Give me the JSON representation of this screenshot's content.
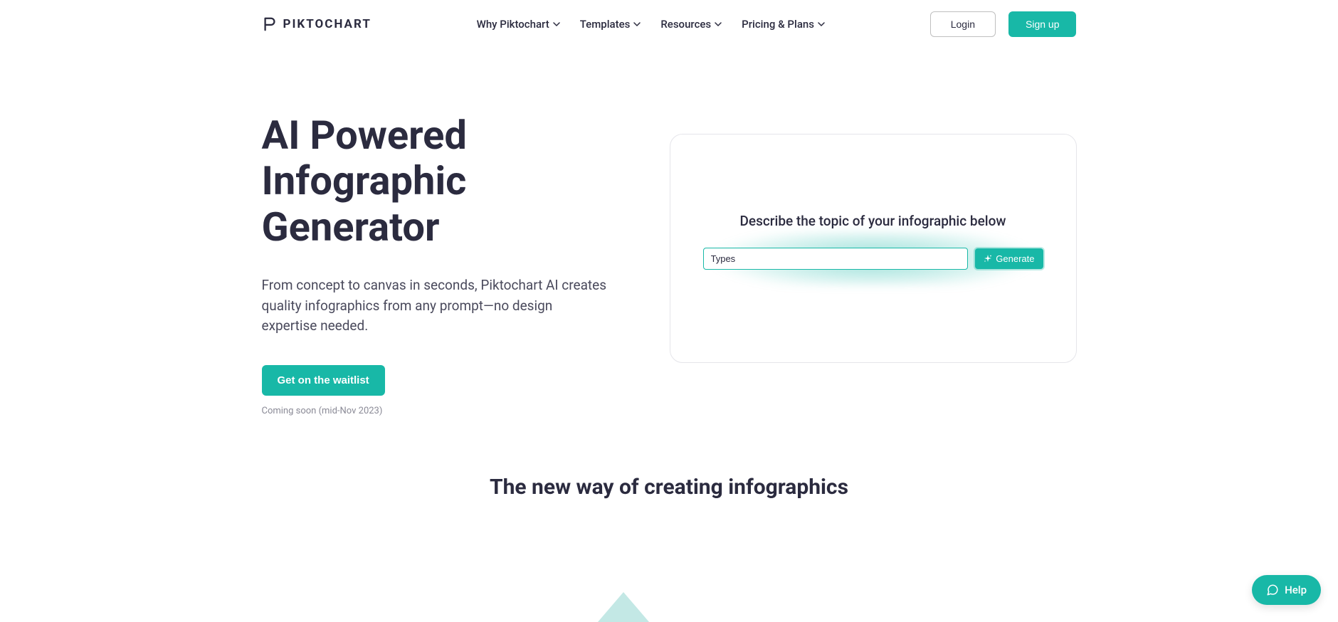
{
  "brand": {
    "name": "PIKTOCHART"
  },
  "nav": {
    "items": [
      {
        "label": "Why Piktochart"
      },
      {
        "label": "Templates"
      },
      {
        "label": "Resources"
      },
      {
        "label": "Pricing & Plans"
      }
    ]
  },
  "auth": {
    "login": "Login",
    "signup": "Sign up"
  },
  "hero": {
    "title": "AI Powered Infographic Generator",
    "description": "From concept to canvas in seconds, Piktochart AI creates quality infographics from any prompt—no design expertise needed.",
    "cta": "Get on the waitlist",
    "subnote": "Coming soon (mid-Nov 2023)"
  },
  "card": {
    "prompt": "Describe the topic of your infographic below",
    "input_value": "Types",
    "generate_label": "Generate"
  },
  "section": {
    "heading": "The new way of creating infographics"
  },
  "help": {
    "label": "Help"
  }
}
